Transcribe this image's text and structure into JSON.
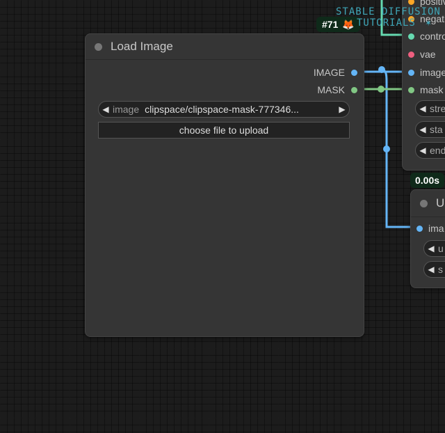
{
  "node_ids": {
    "sampler": "#71",
    "timing": "0.00s"
  },
  "watermark": {
    "line1": "STABLE DIFFUSION",
    "line2": "TUTORIALS"
  },
  "load_image": {
    "title": "Load Image",
    "outputs": [
      {
        "label": "IMAGE",
        "color": "#64b5f6"
      },
      {
        "label": "MASK",
        "color": "#81c784"
      }
    ],
    "image_widget": {
      "name": "image",
      "value": "clipspace/clipspace-mask-777346..."
    },
    "upload_button": "choose file to upload"
  },
  "right_node": {
    "inputs": [
      {
        "label": "positive",
        "color": "#ffa726"
      },
      {
        "label": "negative",
        "color": "#ffa726"
      },
      {
        "label": "control",
        "color": "#66d9b0"
      },
      {
        "label": "vae",
        "color": "#ef5f7f"
      },
      {
        "label": "image",
        "color": "#64b5f6"
      },
      {
        "label": "mask",
        "color": "#81c784"
      }
    ],
    "widgets": [
      "stre",
      "sta",
      "end"
    ]
  },
  "lower_right_node": {
    "title": "U",
    "inputs": [
      {
        "label": "ima",
        "color": "#64b5f6"
      }
    ],
    "widgets": [
      "u",
      "s"
    ]
  },
  "colors": {
    "canvas": "#1c1c1c",
    "node_body": "#353535",
    "image_wire": "#64b5f6",
    "mask_wire": "#81c784",
    "control_wire": "#66d9b0"
  }
}
